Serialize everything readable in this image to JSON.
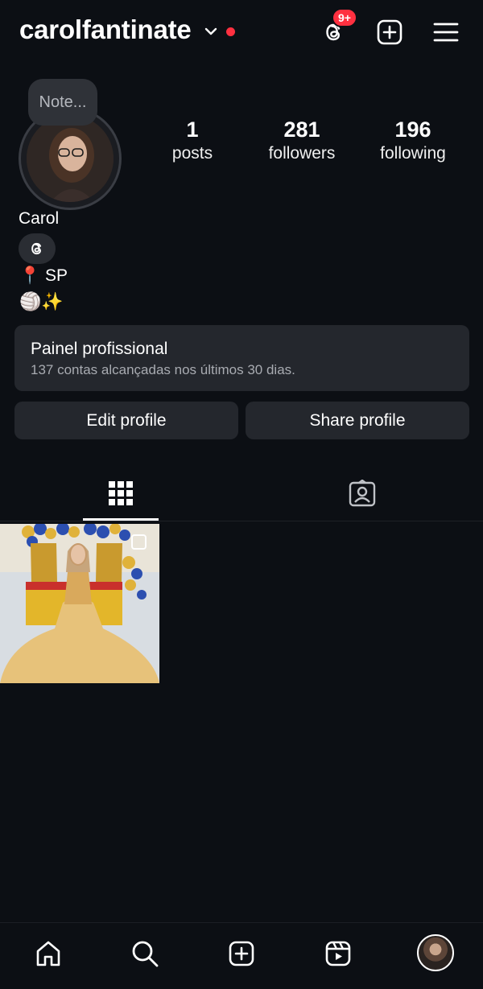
{
  "header": {
    "username": "carolfantinate",
    "threads_badge": "9+"
  },
  "note": {
    "placeholder": "Note..."
  },
  "stats": [
    {
      "num": "1",
      "label": "posts"
    },
    {
      "num": "281",
      "label": "followers"
    },
    {
      "num": "196",
      "label": "following"
    }
  ],
  "profile": {
    "name": "Carol",
    "bio_line1": "📍 SP",
    "bio_line2": "🏐✨"
  },
  "dashboard": {
    "title": "Painel profissional",
    "subtitle": "137 contas alcançadas nos últimos 30 dias."
  },
  "buttons": {
    "edit": "Edit profile",
    "share": "Share profile"
  },
  "colors": {
    "background": "#0c0f14",
    "card": "#24272d",
    "accent_red": "#ff3040"
  },
  "icons": {
    "top": [
      "chevron-down-icon",
      "threads-icon",
      "new-post-icon",
      "menu-icon"
    ],
    "tabs": [
      "grid-icon",
      "tagged-icon"
    ],
    "nav": [
      "home-icon",
      "search-icon",
      "create-icon",
      "reels-icon",
      "profile-avatar"
    ]
  }
}
